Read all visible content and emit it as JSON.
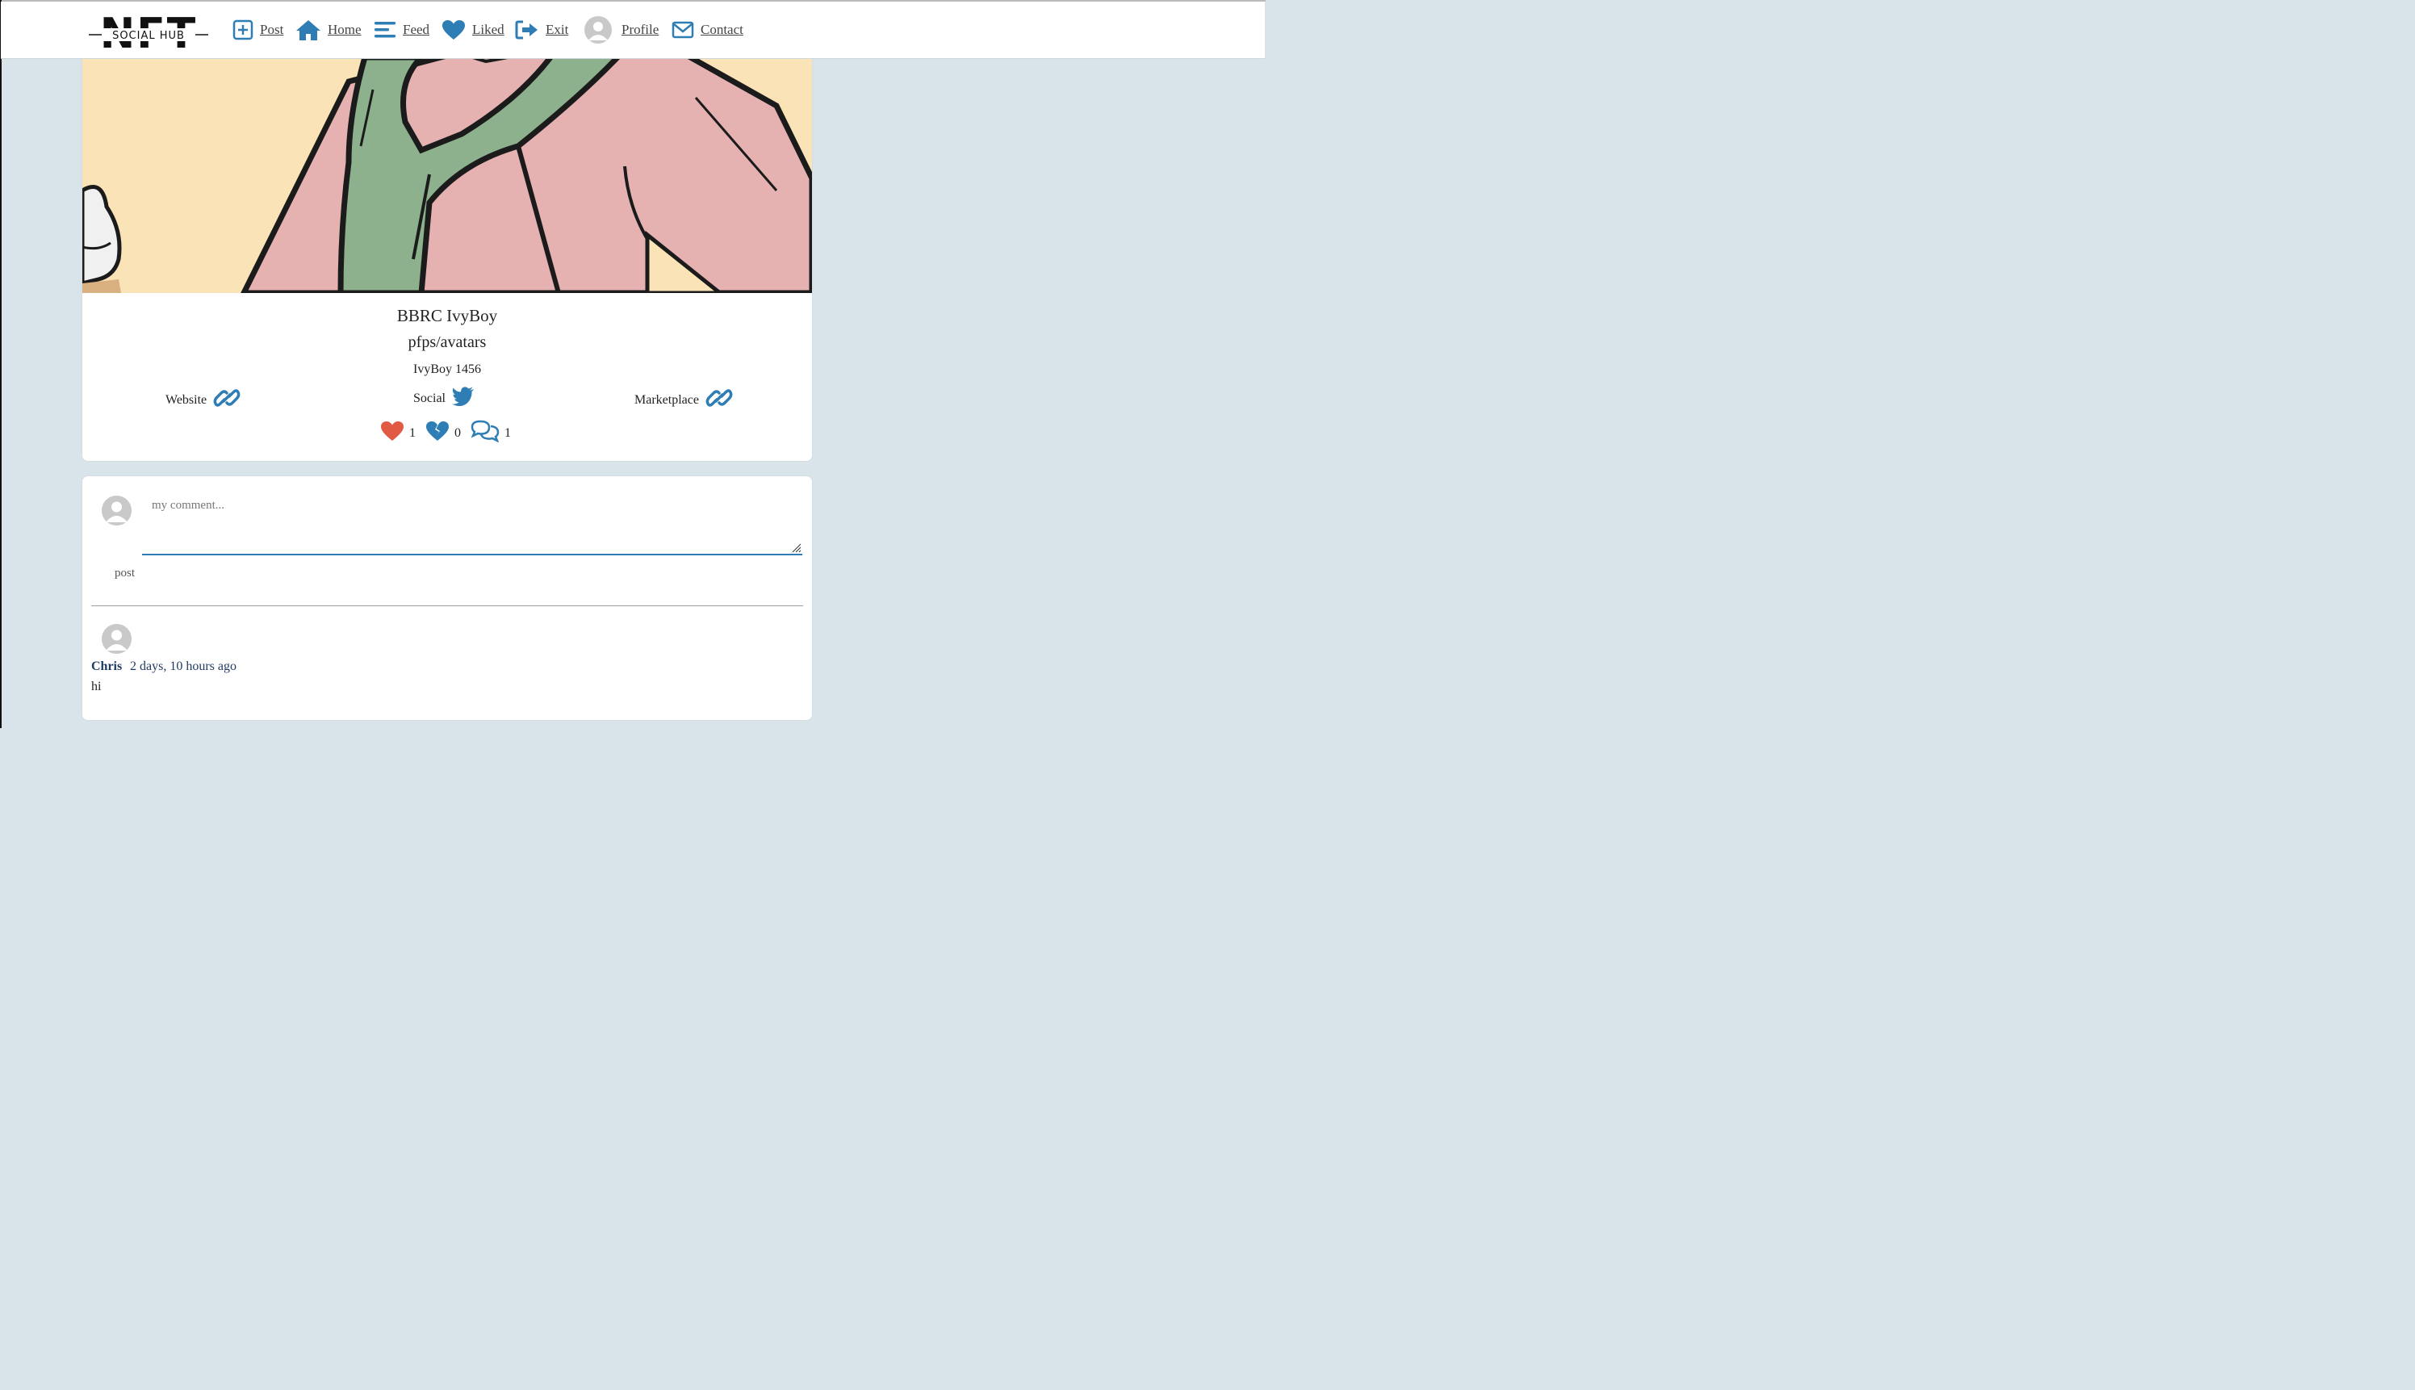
{
  "nav": {
    "logo_text": "NFT",
    "logo_sub": "SOCIAL HUB",
    "items": [
      {
        "label": "Post",
        "icon": "plus-square-icon"
      },
      {
        "label": "Home",
        "icon": "home-icon"
      },
      {
        "label": "Feed",
        "icon": "bars-icon"
      },
      {
        "label": "Liked",
        "icon": "heart-icon"
      },
      {
        "label": "Exit",
        "icon": "sign-out-icon"
      },
      {
        "label": "Profile",
        "icon": "user-avatar-icon"
      },
      {
        "label": "Contact",
        "icon": "envelope-icon"
      }
    ]
  },
  "post": {
    "title": "BBRC IvyBoy",
    "category": "pfps/avatars",
    "item": "IvyBoy 1456",
    "links": [
      {
        "label": "Website",
        "icon": "link-icon"
      },
      {
        "label": "Social",
        "icon": "twitter-icon"
      },
      {
        "label": "Marketplace",
        "icon": "link-icon"
      }
    ],
    "stats": {
      "likes": "1",
      "dislikes": "0",
      "comments": "1"
    }
  },
  "comment_form": {
    "placeholder": "my comment...",
    "value": "",
    "post_label": "post"
  },
  "comments": [
    {
      "author": "Chris",
      "time": "2 days, 10 hours ago",
      "text": "hi"
    }
  ],
  "colors": {
    "accent": "#2e7db5",
    "like": "#e05a44",
    "background": "#d8e4ea"
  }
}
